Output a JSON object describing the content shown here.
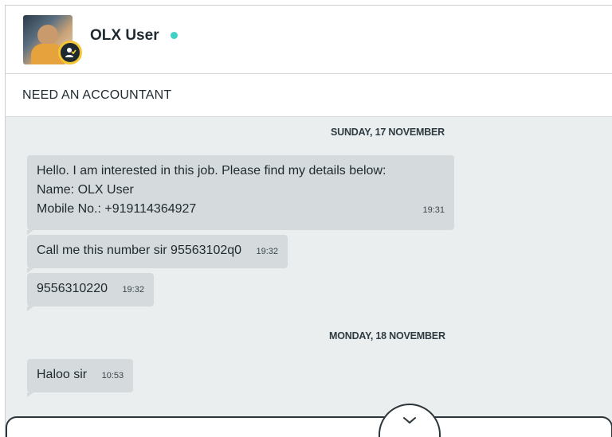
{
  "header": {
    "username": "OLX User",
    "status_color": "#3fd0c6"
  },
  "subject": {
    "title": "NEED AN ACCOUNTANT"
  },
  "messages": {
    "groups": [
      {
        "date": "SUNDAY, 17 NOVEMBER",
        "items": [
          {
            "lines": [
              "Hello. I am interested in this job. Please find my details below:",
              "Name: OLX User",
              "Mobile No.: +919114364927"
            ],
            "time": "19:31"
          },
          {
            "text": "Call me this number sir 95563102q0",
            "time": "19:32"
          },
          {
            "text": "9556310220",
            "time": "19:32"
          }
        ]
      },
      {
        "date": "MONDAY, 18 NOVEMBER",
        "items": [
          {
            "text": "Haloo sir",
            "time": "10:53"
          }
        ]
      }
    ]
  },
  "icons": {
    "badge": "verified-badge-icon",
    "scroll": "chevron-down-icon"
  },
  "colors": {
    "bubble": "#d5dadc",
    "background": "#ebeeef",
    "online": "#3fd0c6"
  }
}
